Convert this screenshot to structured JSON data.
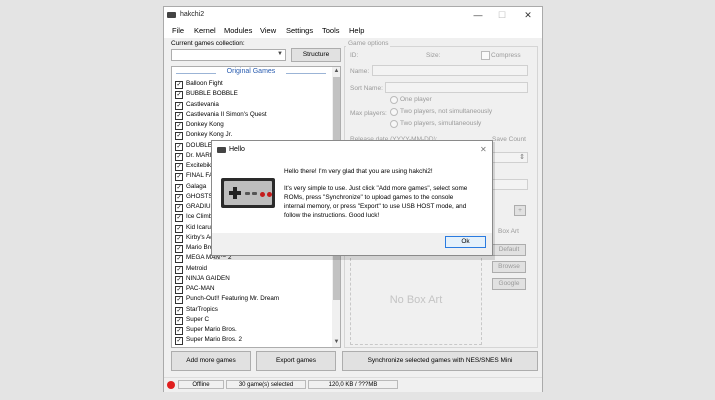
{
  "window": {
    "title": "hakchi2",
    "min": "—",
    "max": "☐",
    "close": "✕"
  },
  "menu": [
    "File",
    "Kernel",
    "Modules",
    "View",
    "Settings",
    "Tools",
    "Help"
  ],
  "collection": {
    "label": "Current games collection:",
    "structure_button": "Structure"
  },
  "games": {
    "header": "Original Games",
    "items": [
      "Balloon Fight",
      "BUBBLE BOBBLE",
      "Castlevania",
      "Castlevania II Simon's Quest",
      "Donkey Kong",
      "Donkey Kong Jr.",
      "DOUBLE DRAGON II: The R",
      "Dr. MARIO",
      "Excitebike",
      "FINAL FANTASY",
      "Galaga",
      "GHOSTS'N GOBLINS",
      "GRADIUS",
      "Ice Climber",
      "Kid Icarus",
      "Kirby's Adventure",
      "Mario Bros.",
      "MEGA MAN™ 2",
      "Metroid",
      "NINJA GAIDEN",
      "PAC-MAN",
      "Punch-Out!! Featuring Mr. Dream",
      "StarTropics",
      "Super C",
      "Super Mario Bros.",
      "Super Mario Bros. 2"
    ]
  },
  "options": {
    "legend": "Game options",
    "id_label": "ID:",
    "size_label": "Size:",
    "compress_label": "Compress",
    "name_label": "Name:",
    "sort_label": "Sort Name:",
    "max_players_label": "Max players:",
    "radio_one": "One player",
    "radio_two_not": "Two players, not simultaneously",
    "radio_two_sim": "Two players, simultaneously",
    "release_label": "Release date (YYYY-MM-DD):",
    "save_count_label": "Save Count",
    "box_art_label": "Box Art",
    "default_button": "Default",
    "browse_button": "Browse",
    "google_button": "Google",
    "no_box_art": "No Box Art",
    "plus_button": "+"
  },
  "bottom_buttons": {
    "add": "Add more games",
    "export": "Export games",
    "sync": "Synchronize selected games with NES/SNES Mini"
  },
  "status": {
    "offline": "Offline",
    "selected": "30 game(s) selected",
    "size": "120,0 KB / ???MB"
  },
  "dialog": {
    "title": "Hello",
    "close": "✕",
    "line1": "Hello there! I'm very glad that you are using hakchi2!",
    "line2": "It's very simple to use. Just click \"Add more games\", select some",
    "line3": "ROMs, press \"Synchronize\" to upload games to the console",
    "line4": "internal memory, or press \"Export\" to use USB HOST mode, and",
    "line5": "follow the instructions. Good luck!",
    "ok": "Ok"
  },
  "colors": {
    "accent": "#2a7be0",
    "offline_dot": "#e02020",
    "header": "#2a5db0"
  }
}
